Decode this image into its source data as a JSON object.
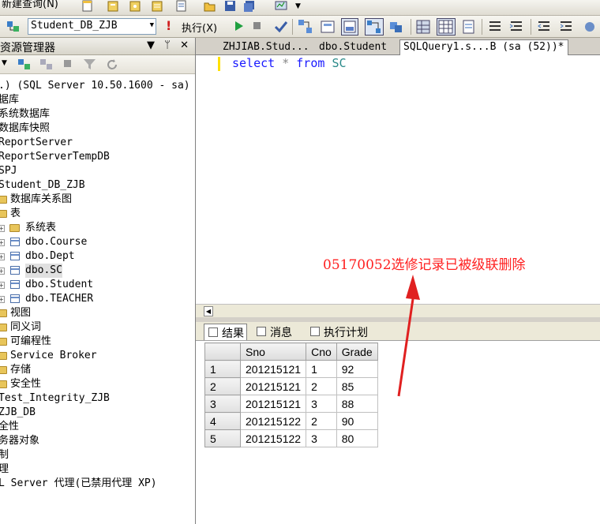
{
  "toolbar": {
    "new_query_label": "新建查询(N)",
    "database_select": "Student_DB_ZJB",
    "execute_label": "执行(X)"
  },
  "explorer": {
    "title": "资源管理器",
    "title_buttons": "▼ ᛘ ✕",
    "tree": [
      {
        "text": ".) (SQL Server 10.50.1600 - sa)",
        "indent": 0,
        "icon": "none",
        "mono": true
      },
      {
        "text": "据库",
        "indent": 0,
        "icon": "none",
        "mono": false
      },
      {
        "text": "系统数据库",
        "indent": 0,
        "icon": "none",
        "mono": false
      },
      {
        "text": "数据库快照",
        "indent": 0,
        "icon": "none",
        "mono": false
      },
      {
        "text": "ReportServer",
        "indent": 0,
        "icon": "none",
        "mono": true
      },
      {
        "text": "ReportServerTempDB",
        "indent": 0,
        "icon": "none",
        "mono": true
      },
      {
        "text": "SPJ",
        "indent": 0,
        "icon": "none",
        "mono": true
      },
      {
        "text": "Student_DB_ZJB",
        "indent": 0,
        "icon": "none",
        "mono": true
      },
      {
        "text": "数据库关系图",
        "indent": 1,
        "icon": "folder",
        "mono": false
      },
      {
        "text": "表",
        "indent": 1,
        "icon": "folder",
        "mono": false
      },
      {
        "text": "系统表",
        "indent": 2,
        "icon": "folder",
        "mono": false,
        "plus": true
      },
      {
        "text": "dbo.Course",
        "indent": 2,
        "icon": "table",
        "mono": true,
        "plus": true
      },
      {
        "text": "dbo.Dept",
        "indent": 2,
        "icon": "table",
        "mono": true,
        "plus": true
      },
      {
        "text": "dbo.SC",
        "indent": 2,
        "icon": "table",
        "mono": true,
        "plus": true,
        "selected": true
      },
      {
        "text": "dbo.Student",
        "indent": 2,
        "icon": "table",
        "mono": true,
        "plus": true
      },
      {
        "text": "dbo.TEACHER",
        "indent": 2,
        "icon": "table",
        "mono": true,
        "plus": true
      },
      {
        "text": "视图",
        "indent": 1,
        "icon": "folder",
        "mono": false
      },
      {
        "text": "同义词",
        "indent": 1,
        "icon": "folder",
        "mono": false
      },
      {
        "text": "可编程性",
        "indent": 1,
        "icon": "folder",
        "mono": false
      },
      {
        "text": "Service Broker",
        "indent": 1,
        "icon": "folder",
        "mono": true
      },
      {
        "text": "存储",
        "indent": 1,
        "icon": "folder",
        "mono": false
      },
      {
        "text": "安全性",
        "indent": 1,
        "icon": "folder",
        "mono": false
      },
      {
        "text": "Test_Integrity_ZJB",
        "indent": 0,
        "icon": "none",
        "mono": true
      },
      {
        "text": "ZJB_DB",
        "indent": 0,
        "icon": "none",
        "mono": true
      },
      {
        "text": "全性",
        "indent": 0,
        "icon": "none",
        "mono": false
      },
      {
        "text": "务器对象",
        "indent": 0,
        "icon": "none",
        "mono": false
      },
      {
        "text": "制",
        "indent": 0,
        "icon": "none",
        "mono": false
      },
      {
        "text": "理",
        "indent": 0,
        "icon": "none",
        "mono": false
      },
      {
        "text": "L Server 代理(已禁用代理 XP)",
        "indent": 0,
        "icon": "none",
        "mono": true
      }
    ]
  },
  "editor": {
    "tabs": [
      {
        "label": "ZHJIAB.Stud...",
        "active": false
      },
      {
        "label": "dbo.Student",
        "active": false
      },
      {
        "label": "SQLQuery1.s...B (sa (52))*",
        "active": true
      }
    ],
    "code": {
      "kw1": "select",
      "op": "*",
      "kw2": "from",
      "table": "SC"
    }
  },
  "annotation": "05170052选修记录已被级联删除",
  "results": {
    "tabs": [
      {
        "label": "结果",
        "active": true
      },
      {
        "label": "消息",
        "active": false
      },
      {
        "label": "执行计划",
        "active": false
      }
    ],
    "columns": [
      "Sno",
      "Cno",
      "Grade"
    ],
    "rows": [
      {
        "n": "1",
        "cells": [
          "201215121",
          "1",
          "92"
        ]
      },
      {
        "n": "2",
        "cells": [
          "201215121",
          "2",
          "85"
        ]
      },
      {
        "n": "3",
        "cells": [
          "201215121",
          "3",
          "88"
        ]
      },
      {
        "n": "4",
        "cells": [
          "201215122",
          "2",
          "90"
        ]
      },
      {
        "n": "5",
        "cells": [
          "201215122",
          "3",
          "80"
        ]
      }
    ]
  },
  "colors": {
    "annotation": "#ff2020",
    "keyword": "#1a1aff",
    "identifier": "#2a8a8a"
  }
}
